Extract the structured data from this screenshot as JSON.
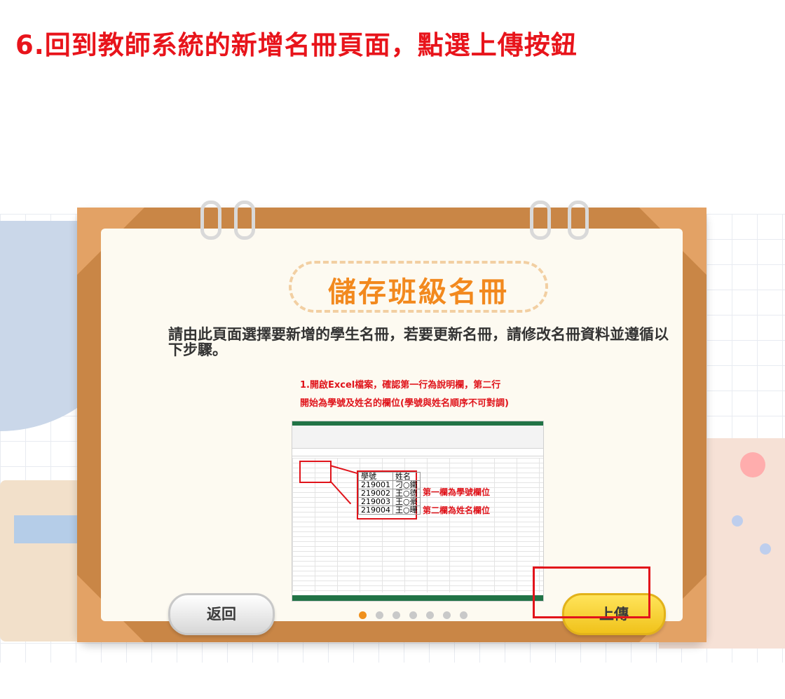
{
  "step_title": "6.回到教師系統的新增名冊頁面，點選上傳按鈕",
  "dialog": {
    "title": "儲存班級名冊",
    "instructions": "請由此頁面選擇要新增的學生名冊，若要更新名冊，請修改名冊資料並遵循以下步驟。",
    "illustration": {
      "caption_line1": "1.開啟Excel檔案，確認第一行為說明欄，第二行",
      "caption_line2": "開始為學號及姓名的欄位(學號與姓名順序不可對調)",
      "zoom_headers": [
        "學號",
        "姓名"
      ],
      "zoom_rows": [
        [
          "219001",
          "刁○鐵"
        ],
        [
          "219002",
          "王○德"
        ],
        [
          "219003",
          "王○豪"
        ],
        [
          "219004",
          "王○曄"
        ]
      ],
      "note_column1": "第一欄為學號欄位",
      "note_column2": "第二欄為姓名欄位"
    },
    "back_button": "返回",
    "upload_button": "上傳",
    "pagination": {
      "total": 7,
      "active": 1
    }
  },
  "colors": {
    "step_title": "#e8141b",
    "board": "#c98646",
    "dialog_title": "#f2891e",
    "upload_button": "#f0c21b",
    "highlight": "#e2141b"
  }
}
